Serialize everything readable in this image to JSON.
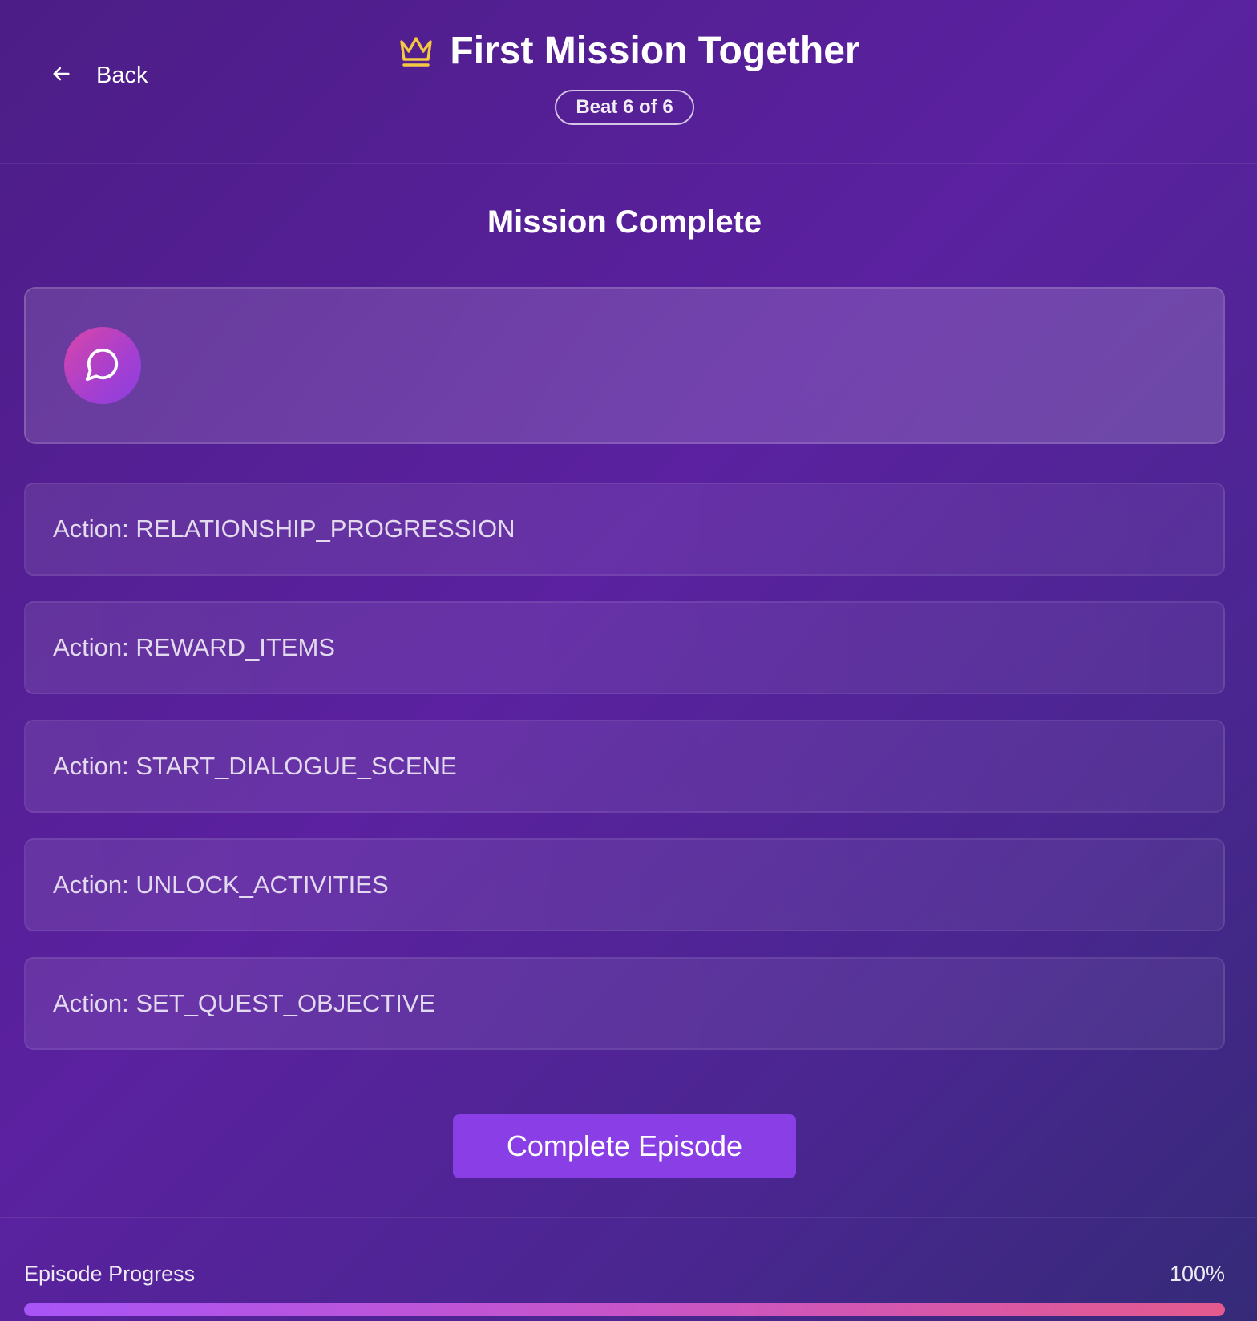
{
  "header": {
    "back_label": "Back",
    "title": "First Mission Together",
    "beat_badge": "Beat 6 of 6",
    "title_icon": "crown-icon",
    "back_icon": "arrow-left-icon"
  },
  "main": {
    "section_title": "Mission Complete",
    "dialogue_card": {
      "avatar_icon": "chat-bubble-icon",
      "text": ""
    },
    "actions": [
      {
        "label": "Action: RELATIONSHIP_PROGRESSION"
      },
      {
        "label": "Action: REWARD_ITEMS"
      },
      {
        "label": "Action: START_DIALOGUE_SCENE"
      },
      {
        "label": "Action: UNLOCK_ACTIVITIES"
      },
      {
        "label": "Action: SET_QUEST_OBJECTIVE"
      }
    ],
    "complete_button_label": "Complete Episode"
  },
  "footer": {
    "progress_label": "Episode Progress",
    "progress_text": "100%",
    "progress_fraction": 1.0
  },
  "colors": {
    "accent": "#8a3ee6",
    "crown": "#f5c842",
    "avatar_gradient_start": "#d946a8",
    "avatar_gradient_end": "#8b3fe0",
    "progress_gradient_start": "#a855f7",
    "progress_gradient_end": "#e45a8e"
  }
}
